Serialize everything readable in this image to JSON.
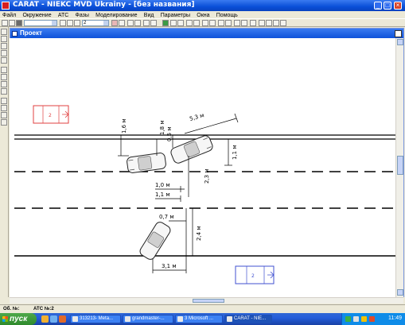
{
  "window": {
    "title": "CARAT - NIEKC MVD Ukrainy - [без названия]"
  },
  "menu": [
    "Файл",
    "Окружение",
    "АТС",
    "Фазы",
    "Моделирование",
    "Вид",
    "Параметры",
    "Окна",
    "Помощь"
  ],
  "toolbar": {
    "layer_value": "",
    "zoom_value": "2"
  },
  "project": {
    "title": "Проект"
  },
  "drawing": {
    "dimensions": [
      "1,6 м",
      "1,8 м",
      "0,5 м",
      "5,3 м",
      "1,1 м",
      "2,3 м",
      "1,0 м",
      "1,1 м",
      "0,7 м",
      "2,4 м",
      "3,1 м"
    ],
    "vehicle_labels": [
      "2",
      "2"
    ],
    "colors": {
      "vehicle_top_left": "#e04040",
      "vehicle_bottom_right": "#4050d0"
    }
  },
  "status": {
    "left": "Об. №:",
    "right": "АТС №:2"
  },
  "taskbar": {
    "start": "пуск",
    "tasks": [
      "313213- Meta...",
      "grandmaster-...",
      "3 Microsoft ...",
      "CARAT - NIE..."
    ],
    "clock": "11:49"
  }
}
